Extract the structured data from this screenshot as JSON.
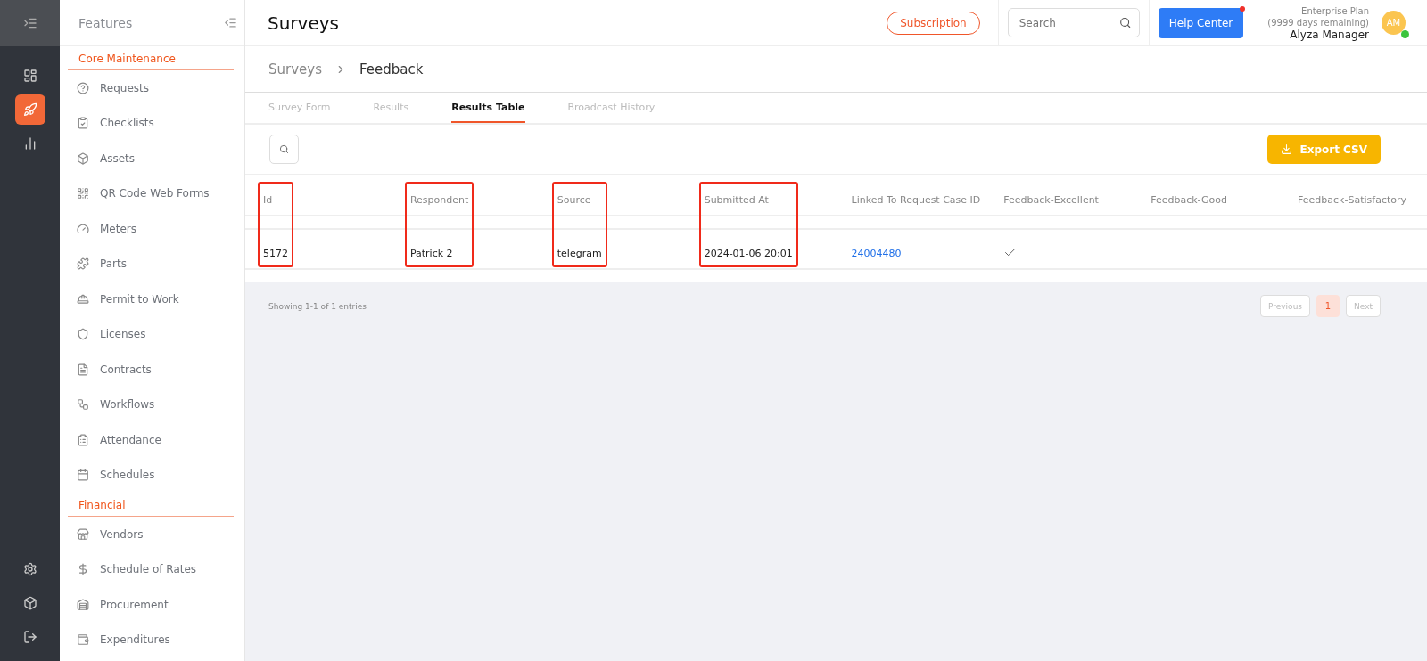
{
  "rail": {
    "items": [
      {
        "kind": "dashboard",
        "selected": false
      },
      {
        "kind": "rocket",
        "selected": true
      },
      {
        "kind": "chart",
        "selected": false
      }
    ],
    "bottom": [
      {
        "kind": "settings"
      },
      {
        "kind": "box"
      },
      {
        "kind": "logout"
      }
    ]
  },
  "features": {
    "title": "Features",
    "sections": [
      {
        "title": "Core Maintenance",
        "items": [
          {
            "label": "Requests",
            "kind": "help"
          },
          {
            "label": "Checklists",
            "kind": "checklist"
          },
          {
            "label": "Assets",
            "kind": "box"
          },
          {
            "label": "QR Code Web Forms",
            "kind": "qr"
          },
          {
            "label": "Meters",
            "kind": "gauge"
          },
          {
            "label": "Parts",
            "kind": "puzzle"
          },
          {
            "label": "Permit to Work",
            "kind": "hardhat"
          },
          {
            "label": "Licenses",
            "kind": "shield"
          },
          {
            "label": "Contracts",
            "kind": "file"
          },
          {
            "label": "Workflows",
            "kind": "workflow"
          },
          {
            "label": "Attendance",
            "kind": "clipboard"
          },
          {
            "label": "Schedules",
            "kind": "calendar"
          }
        ]
      },
      {
        "title": "Financial",
        "items": [
          {
            "label": "Vendors",
            "kind": "store"
          },
          {
            "label": "Schedule of Rates",
            "kind": "dollar"
          },
          {
            "label": "Procurement",
            "kind": "shop"
          },
          {
            "label": "Expenditures",
            "kind": "wallet"
          }
        ]
      }
    ]
  },
  "header": {
    "title": "Surveys",
    "subscription": "Subscription",
    "search": {
      "placeholder": "Search"
    },
    "help": "Help Center",
    "help_notification": true,
    "plan": "Enterprise Plan",
    "plan_remaining": "(9999 days remaining)",
    "user": "Alyza Manager",
    "avatar": "AM",
    "online": true
  },
  "breadcrumb": [
    "Surveys",
    "Feedback"
  ],
  "tabs": [
    {
      "label": "Survey Form",
      "selected": false
    },
    {
      "label": "Results",
      "selected": false
    },
    {
      "label": "Results Table",
      "selected": true
    },
    {
      "label": "Broadcast History",
      "selected": false
    }
  ],
  "export": "Export CSV",
  "table": {
    "columns": [
      {
        "label": "Id",
        "highlighted": true
      },
      {
        "label": "Respondent",
        "highlighted": true
      },
      {
        "label": "Source",
        "highlighted": true
      },
      {
        "label": "Submitted At",
        "highlighted": true
      },
      {
        "label": "Linked To Request Case ID",
        "highlighted": false
      },
      {
        "label": "Feedback-Excellent",
        "highlighted": false
      },
      {
        "label": "Feedback-Good",
        "highlighted": false
      },
      {
        "label": "Feedback-Satisfactory",
        "highlighted": false
      }
    ],
    "rows": [
      [
        {
          "kind": "text",
          "value": "5172"
        },
        {
          "kind": "text",
          "value": "Patrick 2"
        },
        {
          "kind": "text",
          "value": "telegram"
        },
        {
          "kind": "text",
          "value": "2024-01-06 20:01"
        },
        {
          "kind": "link",
          "value": "24004480"
        },
        {
          "kind": "check",
          "checked": true
        },
        {
          "kind": "check",
          "checked": false
        },
        {
          "kind": "check",
          "checked": false
        }
      ]
    ]
  },
  "footer": {
    "summary": "Showing 1-1 of 1 entries",
    "previous": "Previous",
    "pages": [
      {
        "label": "1",
        "selected": true
      }
    ],
    "next": "Next"
  }
}
